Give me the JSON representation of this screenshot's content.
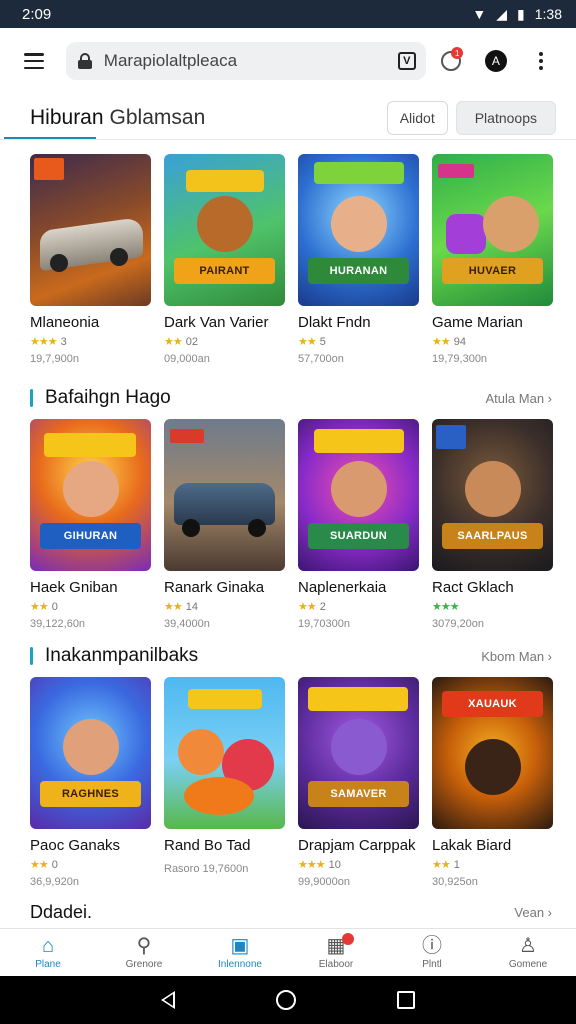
{
  "status_bar": {
    "time": "2:09",
    "right_time": "1:38",
    "battery_glyph": "▮"
  },
  "app_bar": {
    "search_text": "Marapiolaltpleaca",
    "tab_glyph": "V",
    "notification_count": "1",
    "profile_glyph": "A",
    "icons": [
      "menu-icon",
      "lock-icon",
      "tabs-icon",
      "clock-icon",
      "profile-icon",
      "more-vert-icon"
    ]
  },
  "header": {
    "title": "Hiburan",
    "subtitle": "Gblamsan",
    "button_one": "Alidot",
    "button_two": "Platnoops"
  },
  "colors": {
    "accent": "#1aa3c6",
    "active_nav": "#1f86c4",
    "star": "#e8b317",
    "star_green": "#3bb34a"
  },
  "sections": [
    {
      "title": "",
      "more": "",
      "items": [
        {
          "name": "Mlaneonia",
          "stars": "★★★",
          "rating": "3",
          "downloads": "19,7,900n",
          "tag": "",
          "banner": "",
          "star_color": "yellow"
        },
        {
          "name": "Dark Van Varier",
          "stars": "★★",
          "rating": "02",
          "downloads": "09,000an",
          "tag": "",
          "banner": "PAIRANT",
          "star_color": "yellow"
        },
        {
          "name": "Dlakt Fndn",
          "stars": "★★",
          "rating": "5",
          "downloads": "57,700on",
          "tag": "",
          "banner": "HURANAN",
          "star_color": "yellow"
        },
        {
          "name": "Game Marian",
          "stars": "★★",
          "rating": "94",
          "downloads": "19,79,300n",
          "tag": "",
          "banner": "HUVAER",
          "star_color": "yellow"
        }
      ]
    },
    {
      "title": "Bafaihgn Hago",
      "more": "Atula Man ›",
      "items": [
        {
          "name": "Haek Gniban",
          "stars": "★★",
          "rating": "0",
          "downloads": "39,122,60n",
          "tag": "",
          "banner": "GIHURAN",
          "star_color": "yellow"
        },
        {
          "name": "Ranark Ginaka",
          "stars": "★★",
          "rating": "14",
          "downloads": "39,4000n",
          "tag": "",
          "banner": "",
          "star_color": "yellow"
        },
        {
          "name": "Naplenerkaia",
          "stars": "★★",
          "rating": "2",
          "downloads": "19,70300n",
          "tag": "",
          "banner": "SUARDUN",
          "star_color": "yellow"
        },
        {
          "name": "Ract Gklach",
          "stars": "★★★",
          "rating": "",
          "downloads": "3079,20on",
          "tag": "",
          "banner": "SAARLPAUS",
          "star_color": "green"
        }
      ]
    },
    {
      "title": "Inakanmpanilbaks",
      "more": "Kbom Man ›",
      "items": [
        {
          "name": "Paoc Ganaks",
          "stars": "★★",
          "rating": "0",
          "downloads": "36,9,920n",
          "tag": "",
          "banner": "RAGHNES",
          "star_color": "yellow"
        },
        {
          "name": "Rand Bo Tad",
          "stars": "",
          "rating": "",
          "downloads": "Rasoro 19,7600n",
          "tag": "",
          "banner": "",
          "star_color": "yellow"
        },
        {
          "name": "Drapjam Carppak",
          "stars": "★★★",
          "rating": "10",
          "downloads": "99,9000on",
          "tag": "",
          "banner": "SAMAVER",
          "star_color": "yellow"
        },
        {
          "name": "Lakak Biard",
          "stars": "★★",
          "rating": "1",
          "downloads": "30,925on",
          "tag": "",
          "banner": "XAUAUK",
          "star_color": "yellow"
        }
      ]
    }
  ],
  "peek_section": {
    "title": "Ddadei.",
    "more": "Vean ›"
  },
  "bottom_nav": [
    {
      "label": "Plane",
      "glyph": "⌂",
      "active": true,
      "badge": false
    },
    {
      "label": "Grenore",
      "glyph": "⚲",
      "active": false,
      "badge": false
    },
    {
      "label": "Inlennone",
      "glyph": "▣",
      "active": true,
      "badge": false
    },
    {
      "label": "Elaboor",
      "glyph": "▦",
      "active": false,
      "badge": true
    },
    {
      "label": "Plntl",
      "glyph": "ⓘ",
      "active": false,
      "badge": false
    },
    {
      "label": "Gomene",
      "glyph": "♙",
      "active": false,
      "badge": false
    }
  ]
}
